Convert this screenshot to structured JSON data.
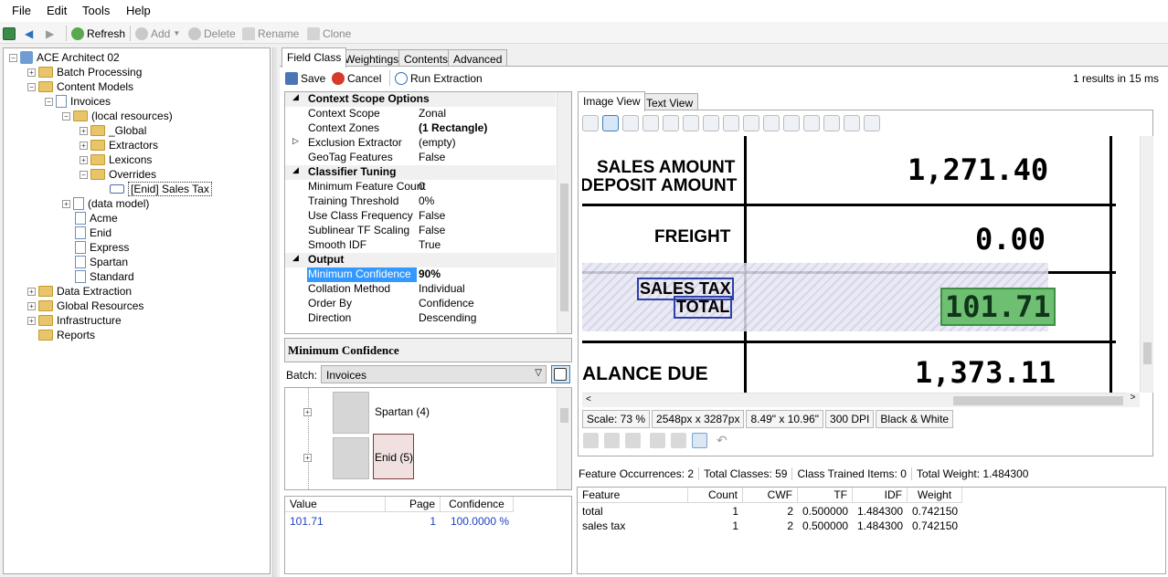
{
  "menu": [
    "File",
    "Edit",
    "Tools",
    "Help"
  ],
  "toolbar": {
    "refresh": "Refresh",
    "add": "Add",
    "delete": "Delete",
    "rename": "Rename",
    "clone": "Clone"
  },
  "tree": {
    "root": "ACE Architect 02",
    "batch_processing": "Batch Processing",
    "content_models": "Content Models",
    "invoices": "Invoices",
    "local_resources": "(local resources)",
    "global": "_Global",
    "extractors": "Extractors",
    "lexicons": "Lexicons",
    "overrides": "Overrides",
    "enid_sales_tax": "[Enid] Sales Tax",
    "data_model": "(data model)",
    "acme": "Acme",
    "enid": "Enid",
    "express": "Express",
    "spartan": "Spartan",
    "standard": "Standard",
    "data_extraction": "Data Extraction",
    "global_resources": "Global Resources",
    "infrastructure": "Infrastructure",
    "reports": "Reports"
  },
  "tabs": [
    "Field Class",
    "Weightings",
    "Contents",
    "Advanced"
  ],
  "fc_toolbar": {
    "save": "Save",
    "cancel": "Cancel",
    "run": "Run Extraction",
    "results": "1 results in 15 ms"
  },
  "props": {
    "cat1": "Context Scope Options",
    "context_scope": {
      "k": "Context Scope",
      "v": "Zonal"
    },
    "context_zones": {
      "k": "Context Zones",
      "v": "(1 Rectangle)"
    },
    "exclusion": {
      "k": "Exclusion Extractor",
      "v": "(empty)"
    },
    "geotag": {
      "k": "GeoTag Features",
      "v": "False"
    },
    "cat2": "Classifier Tuning",
    "min_feat": {
      "k": "Minimum Feature Count",
      "v": "0"
    },
    "train_thr": {
      "k": "Training Threshold",
      "v": "0%"
    },
    "use_class": {
      "k": "Use Class Frequency",
      "v": "False"
    },
    "sublinear": {
      "k": "Sublinear TF Scaling",
      "v": "False"
    },
    "smooth": {
      "k": "Smooth IDF",
      "v": "True"
    },
    "cat3": "Output",
    "min_conf": {
      "k": "Minimum Confidence",
      "v": "90%"
    },
    "collation": {
      "k": "Collation Method",
      "v": "Individual"
    },
    "order": {
      "k": "Order By",
      "v": "Confidence"
    },
    "direction": {
      "k": "Direction",
      "v": "Descending"
    }
  },
  "help_title": "Minimum Confidence",
  "batch": {
    "label": "Batch:",
    "value": "Invoices",
    "items": [
      {
        "name": "Spartan (4)"
      },
      {
        "name": "Enid (5)"
      }
    ]
  },
  "results": {
    "headers": [
      "Value",
      "Page",
      "Confidence"
    ],
    "rows": [
      {
        "value": "101.71",
        "page": "1",
        "confidence": "100.0000 %"
      }
    ]
  },
  "view_tabs": [
    "Image View",
    "Text View"
  ],
  "document": {
    "sales_amount": "SALES AMOUNT",
    "deposit_amount": "DEPOSIT AMOUNT",
    "amount1": "1,271.40",
    "freight": "FREIGHT",
    "amount2": "0.00",
    "sales_tax": "SALES TAX",
    "total": "TOTAL",
    "amount3": "101.71",
    "balance_due": "ALANCE DUE",
    "amount4": "1,373.11"
  },
  "status": {
    "scale": "Scale: 73 %",
    "pixels": "2548px x 3287px",
    "inches": "8.49\" x 10.96\"",
    "dpi": "300 DPI",
    "mode": "Black & White"
  },
  "features": {
    "summary": {
      "occ_label": "Feature Occurrences:",
      "occ": "2",
      "classes_label": "Total Classes:",
      "classes": "59",
      "trained_label": "Class Trained Items:",
      "trained": "0",
      "weight_label": "Total Weight:",
      "weight": "1.484300"
    },
    "headers": [
      "Feature",
      "Count",
      "CWF",
      "TF",
      "IDF",
      "Weight"
    ],
    "rows": [
      {
        "feature": "total",
        "count": "1",
        "cwf": "2",
        "tf": "0.500000",
        "idf": "1.484300",
        "weight": "0.742150"
      },
      {
        "feature": "sales tax",
        "count": "1",
        "cwf": "2",
        "tf": "0.500000",
        "idf": "1.484300",
        "weight": "0.742150"
      }
    ]
  },
  "colors": {
    "accent": "#3399ff",
    "highlight_box": "#4caf50",
    "zone_fill": "#d6d6ea"
  }
}
